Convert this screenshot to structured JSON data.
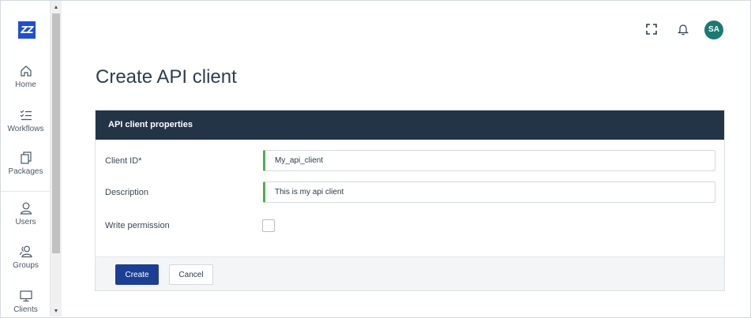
{
  "app": {
    "logo_text": "ZZ",
    "brand_color": "#1f4fd1"
  },
  "sidebar": {
    "items": [
      {
        "label": "Home",
        "icon": "home-icon"
      },
      {
        "label": "Workflows",
        "icon": "checklist-icon"
      },
      {
        "label": "Packages",
        "icon": "packages-icon"
      },
      {
        "label": "Users",
        "icon": "user-icon"
      },
      {
        "label": "Groups",
        "icon": "group-icon"
      },
      {
        "label": "Clients",
        "icon": "monitor-icon"
      }
    ]
  },
  "header": {
    "icons": [
      "fullscreen-icon",
      "bell-icon"
    ],
    "avatar_initials": "SA",
    "avatar_color": "#1b7b73"
  },
  "page": {
    "title": "Create API client"
  },
  "form": {
    "section_title": "API client properties",
    "header_color": "#243447",
    "fields": {
      "client_id": {
        "label": "Client ID*",
        "value": "My_api_client"
      },
      "description": {
        "label": "Description",
        "value": "This is my api client"
      },
      "write_permission": {
        "label": "Write permission",
        "checked": false
      }
    },
    "valid_color": "#4caf50",
    "buttons": {
      "create": "Create",
      "cancel": "Cancel"
    },
    "primary_color": "#1c3f94"
  }
}
